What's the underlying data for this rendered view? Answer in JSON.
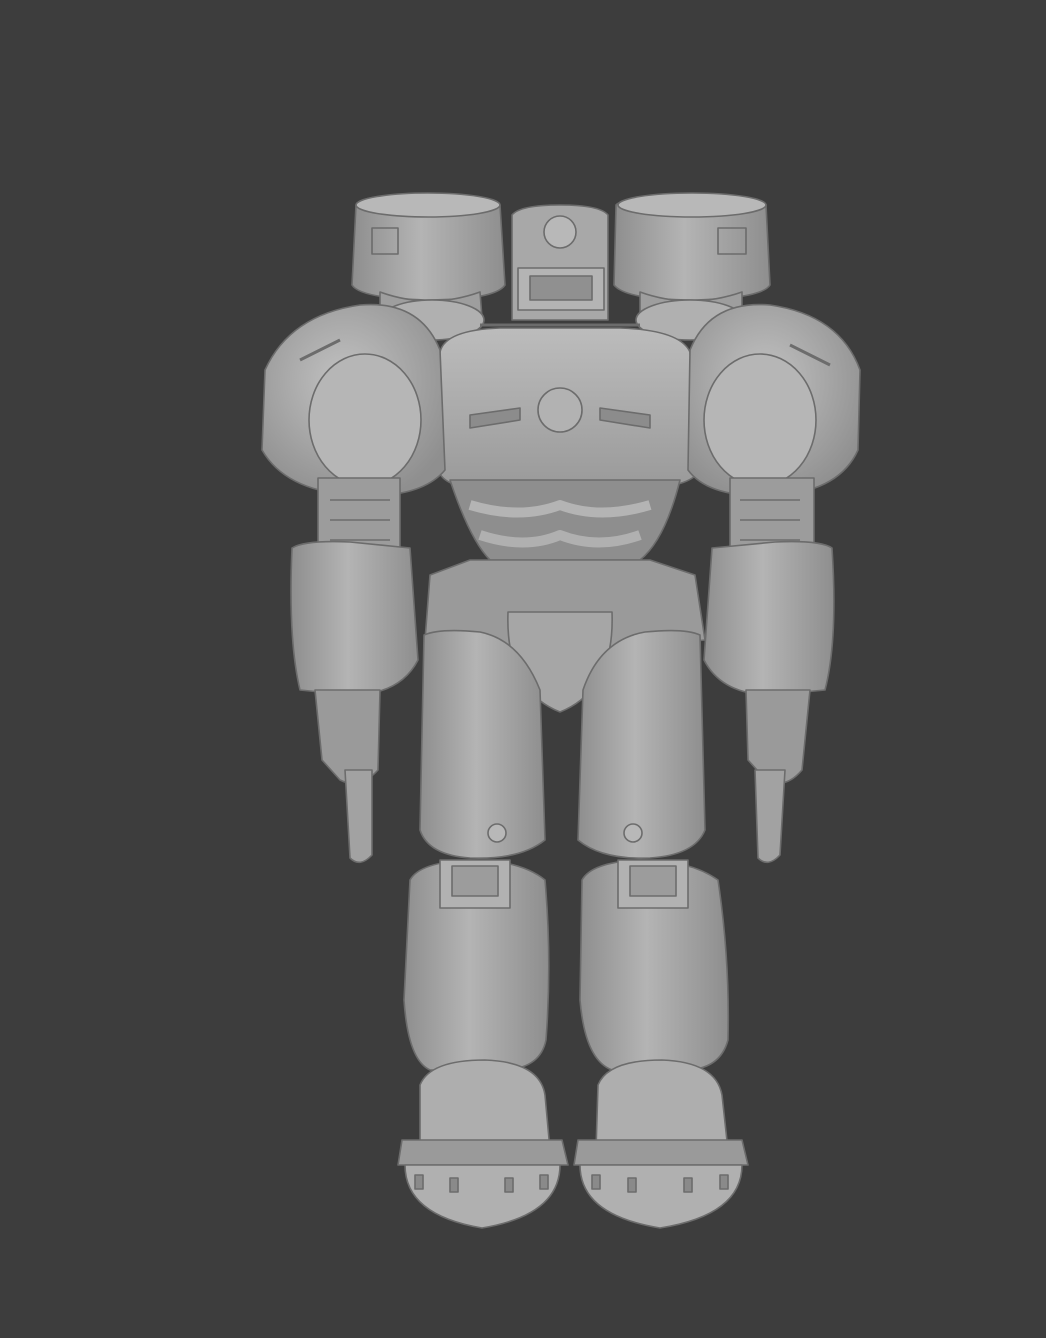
{
  "viewport": {
    "background": "#3d3d3d",
    "model_base_color": "#a4a4a4",
    "model_light_color": "#bcbcbc",
    "model_shadow_color": "#848484",
    "model_edge_color": "#6c6c6c",
    "subject": "armored-suit-mesh-back-view"
  }
}
